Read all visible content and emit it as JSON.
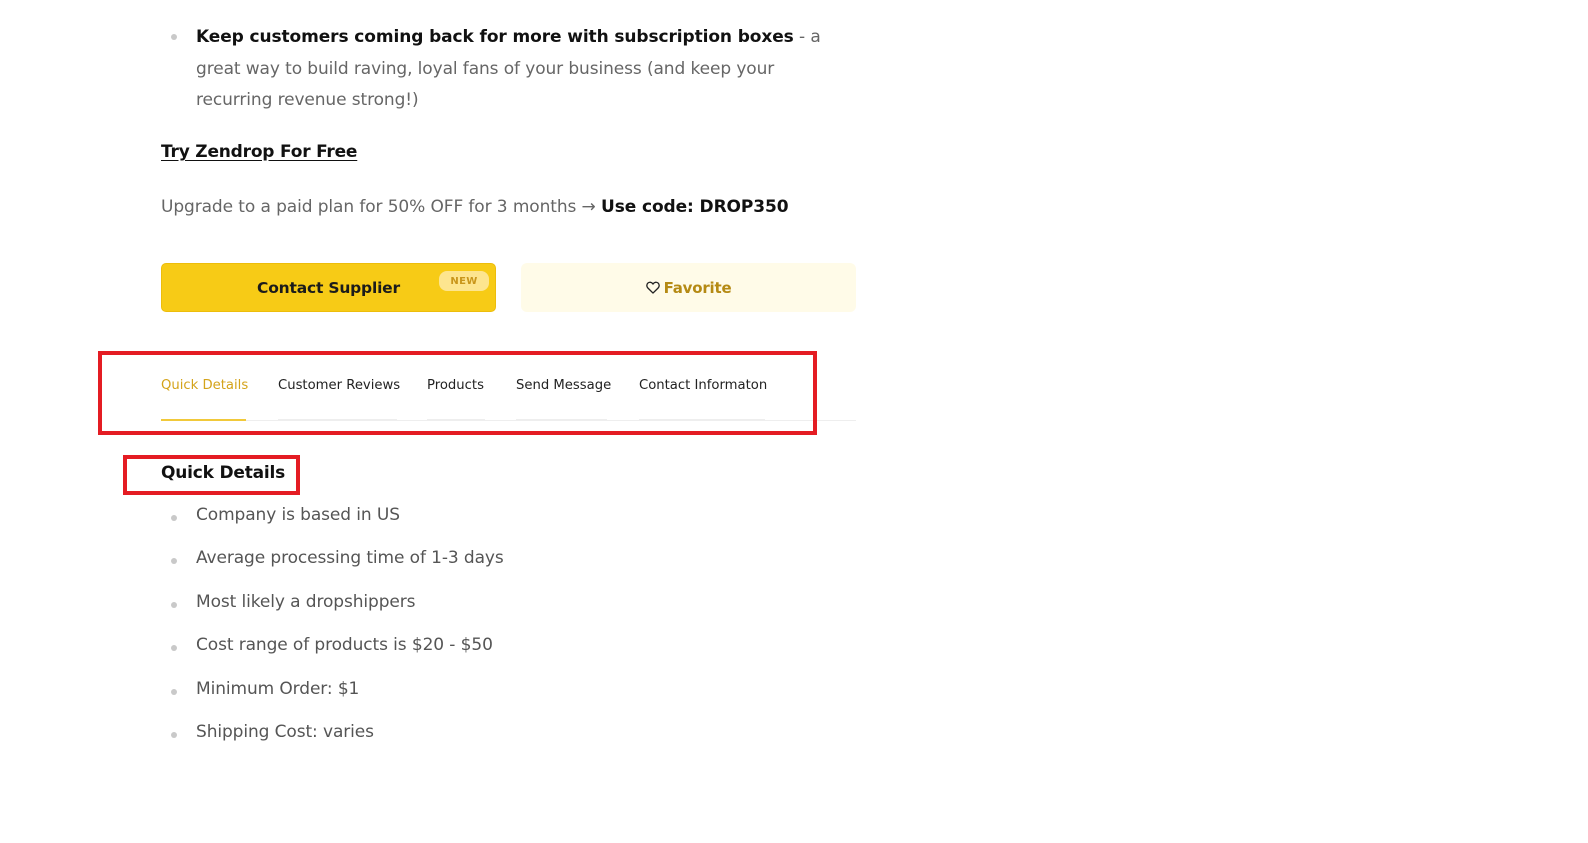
{
  "top_bullet": {
    "bold": "Keep customers coming back for more with subscription boxes",
    "rest": " - a great way to build raving, loyal fans of your business (and keep your recurring revenue strong!)"
  },
  "try_link": "Try Zendrop For Free",
  "upgrade": {
    "text": "Upgrade to a paid plan for 50% OFF for 3 months → ",
    "code": "Use code: DROP350"
  },
  "buttons": {
    "contact_label": "Contact Supplier",
    "new_badge": "NEW",
    "favorite_label": "Favorite"
  },
  "tabs": [
    {
      "label": "Quick Details",
      "active": true
    },
    {
      "label": "Customer Reviews",
      "active": false
    },
    {
      "label": "Products",
      "active": false
    },
    {
      "label": "Send Message",
      "active": false
    },
    {
      "label": "Contact Informaton",
      "active": false
    }
  ],
  "section_title": "Quick Details",
  "details": [
    "Company is based in US",
    "Average processing time of 1-3 days",
    "Most likely a dropshippers",
    "Cost range of products is $20 - $50",
    "Minimum Order: $1",
    "Shipping Cost: varies"
  ],
  "colors": {
    "accent": "#f7cb16",
    "active_tab": "#d4a31a",
    "favorite_text": "#b58a14",
    "favorite_bg": "#fffbe8",
    "highlight_box": "#e41c23"
  },
  "icons": {
    "favorite": "heart-icon",
    "bullet": "bullet-dot-icon"
  }
}
